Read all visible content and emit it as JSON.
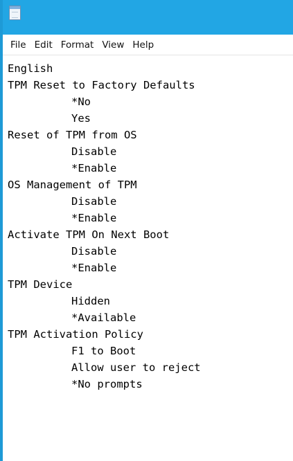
{
  "menu": [
    "File",
    "Edit",
    "Format",
    "View",
    "Help"
  ],
  "document": {
    "lines": [
      {
        "text": "English",
        "indent": false
      },
      {
        "text": "TPM Reset to Factory Defaults",
        "indent": false
      },
      {
        "text": "*No",
        "indent": true
      },
      {
        "text": "Yes",
        "indent": true
      },
      {
        "text": "Reset of TPM from OS",
        "indent": false
      },
      {
        "text": "Disable",
        "indent": true
      },
      {
        "text": "*Enable",
        "indent": true
      },
      {
        "text": "OS Management of TPM",
        "indent": false
      },
      {
        "text": "Disable",
        "indent": true
      },
      {
        "text": "*Enable",
        "indent": true
      },
      {
        "text": "Activate TPM On Next Boot",
        "indent": false
      },
      {
        "text": "Disable",
        "indent": true
      },
      {
        "text": "*Enable",
        "indent": true
      },
      {
        "text": "TPM Device",
        "indent": false
      },
      {
        "text": "Hidden",
        "indent": true
      },
      {
        "text": "*Available",
        "indent": true
      },
      {
        "text": "TPM Activation Policy",
        "indent": false
      },
      {
        "text": "F1 to Boot",
        "indent": true
      },
      {
        "text": "Allow user to reject",
        "indent": true
      },
      {
        "text": "*No prompts",
        "indent": true
      }
    ]
  },
  "colors": {
    "titlebar": "#22a6e4",
    "window_border": "#1e9ad6"
  },
  "icons": {
    "app": "notepad-icon"
  }
}
